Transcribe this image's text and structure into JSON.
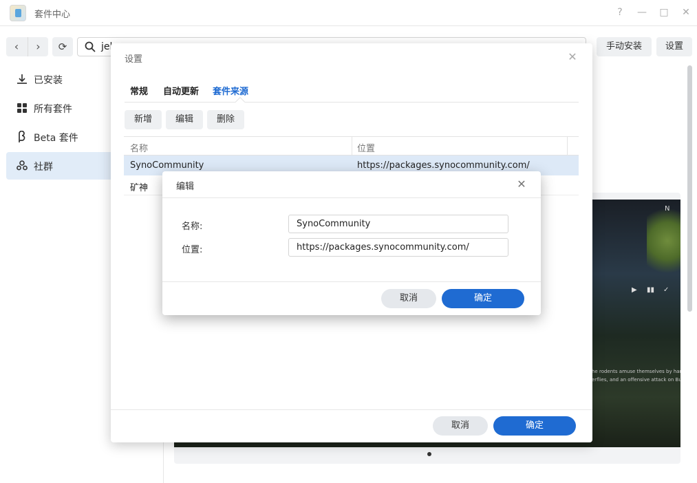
{
  "window": {
    "title": "套件中心",
    "help": "?",
    "minimize": "—",
    "maximize": "□",
    "close": "✕"
  },
  "toolbar": {
    "back": "‹",
    "forward": "›",
    "refresh": "⟳",
    "search_value": "jel",
    "manual_install": "手动安装",
    "settings": "设置"
  },
  "sidebar": {
    "items": [
      {
        "label": "已安装",
        "icon": "download-icon"
      },
      {
        "label": "所有套件",
        "icon": "grid-icon"
      },
      {
        "label": "Beta 套件",
        "icon": "beta-icon"
      },
      {
        "label": "社群",
        "icon": "community-icon",
        "active": true
      }
    ]
  },
  "media": {
    "caption_line1": "he rodents amuse themselves by harass",
    "caption_line2": "erflies, and an offensive attack on Bunn",
    "play": "▶",
    "pause": "▮▮",
    "check": "✓",
    "corner": "N"
  },
  "settings_dialog": {
    "title": "设置",
    "close": "✕",
    "tabs": [
      {
        "label": "常规"
      },
      {
        "label": "自动更新"
      },
      {
        "label": "套件来源",
        "active": true
      }
    ],
    "actions": {
      "add": "新增",
      "edit": "编辑",
      "delete": "删除"
    },
    "columns": {
      "name": "名称",
      "location": "位置"
    },
    "rows": [
      {
        "name": "SynoCommunity",
        "location": "https://packages.synocommunity.com/",
        "selected": true
      },
      {
        "name": "矿神",
        "location": ""
      }
    ],
    "cancel": "取消",
    "ok": "确定"
  },
  "edit_dialog": {
    "title": "编辑",
    "close": "✕",
    "name_label": "名称:",
    "name_value": "SynoCommunity",
    "location_label": "位置:",
    "location_value": "https://packages.synocommunity.com/",
    "cancel": "取消",
    "ok": "确定"
  },
  "colors": {
    "accent": "#1f6bd2",
    "selected_row": "#dde9f7",
    "sidebar_active": "#e1ecf8"
  }
}
